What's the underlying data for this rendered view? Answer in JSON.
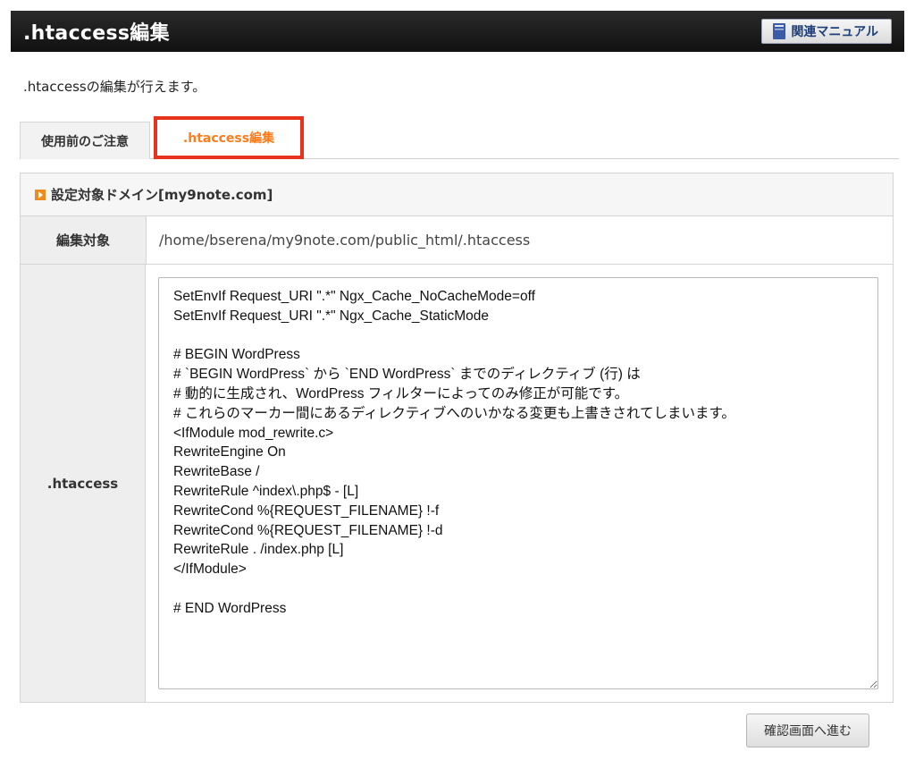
{
  "header": {
    "title": ".htaccess編集",
    "manual_label": "関連マニュアル",
    "manual_icon": "book-icon"
  },
  "intro": ".htaccessの編集が行えます。",
  "tabs": [
    {
      "label": "使用前のご注意",
      "active": false
    },
    {
      "label": ".htaccess編集",
      "active": true
    }
  ],
  "panel": {
    "heading": "設定対象ドメイン[my9note.com]",
    "rows": [
      {
        "label": "編集対象",
        "value": "/home/bserena/my9note.com/public_html/.htaccess"
      },
      {
        "label": ".htaccess"
      }
    ],
    "editor_content": "SetEnvIf Request_URI \".*\" Ngx_Cache_NoCacheMode=off\nSetEnvIf Request_URI \".*\" Ngx_Cache_StaticMode\n\n# BEGIN WordPress\n# `BEGIN WordPress` から `END WordPress` までのディレクティブ (行) は\n# 動的に生成され、WordPress フィルターによってのみ修正が可能です。\n# これらのマーカー間にあるディレクティブへのいかなる変更も上書きされてしまいます。\n<IfModule mod_rewrite.c>\nRewriteEngine On\nRewriteBase /\nRewriteRule ^index\\.php$ - [L]\nRewriteCond %{REQUEST_FILENAME} !-f\nRewriteCond %{REQUEST_FILENAME} !-d\nRewriteRule . /index.php [L]\n</IfModule>\n\n# END WordPress"
  },
  "confirm_button": "確認画面へ進む",
  "colors": {
    "header_bg": "#1a1a1a",
    "active_tab_text": "#ff7a1a",
    "active_tab_border": "#e8321c",
    "heading_icon": "#f08a1c"
  }
}
